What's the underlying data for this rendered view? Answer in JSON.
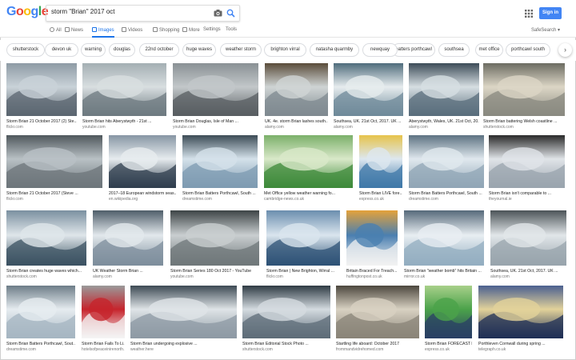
{
  "header": {
    "logo_letters": [
      "G",
      "o",
      "o",
      "g",
      "l",
      "e"
    ],
    "logo_colors": [
      "#4285f4",
      "#ea4335",
      "#fbbc05",
      "#4285f4",
      "#34a853",
      "#ea4335"
    ],
    "query": "storm \"Brian\" 2017 oct",
    "signin_label": "Sign in",
    "apps_icon": "apps-grid-icon",
    "camera_icon": "camera-icon",
    "search_icon": "search-icon"
  },
  "tabs": [
    {
      "label": "All",
      "icon": "search-icon",
      "active": false
    },
    {
      "label": "News",
      "icon": "news-icon",
      "active": false
    },
    {
      "label": "Images",
      "icon": "image-icon",
      "active": true
    },
    {
      "label": "Videos",
      "icon": "video-icon",
      "active": false
    },
    {
      "label": "Shopping",
      "icon": "tag-icon",
      "active": false
    },
    {
      "label": "More",
      "icon": "more-icon",
      "active": false
    },
    {
      "label": "Settings",
      "icon": "",
      "active": false
    },
    {
      "label": "Tools",
      "icon": "",
      "active": false
    }
  ],
  "safesearch_label": "SafeSearch ▾",
  "accent_color": "#1a73e8",
  "chips": [
    "shutterstock",
    "devon uk",
    "warning",
    "douglas",
    "22nd october",
    "huge waves",
    "weather storm",
    "brighton virral",
    "natasha quarmby",
    "newquay",
    "batters porthcawl",
    "southsea",
    "met office",
    "porthcawl south"
  ],
  "results": [
    {
      "caption": "Storm Brian 21 October 2017 (2) Ste...",
      "source": "flickr.com",
      "palette": [
        "#5b6670",
        "#c9d2d8",
        "#8e9ba5"
      ]
    },
    {
      "caption": "Storm Brian hits Aberystwyth - 21st ...",
      "source": "youtube.com",
      "palette": [
        "#6d7a80",
        "#d8dee0",
        "#a4afb3"
      ]
    },
    {
      "caption": "Storm Brian Douglas, Isle of Man ...",
      "source": "youtube.com",
      "palette": [
        "#585e62",
        "#c2c7c9",
        "#8a9195"
      ]
    },
    {
      "caption": "UK. 4e. storm Brian lashes south...",
      "source": "alamy.com",
      "palette": [
        "#7f8a90",
        "#cfd4d4",
        "#5a4c3a"
      ]
    },
    {
      "caption": "Southsea, UK. 21st Oct, 2017. UK ...",
      "source": "alamy.com",
      "palette": [
        "#6f8a9a",
        "#e6ecee",
        "#4f6c7c"
      ]
    },
    {
      "caption": "Aberystwyth, Wales, UK. 21st Oct, 20...",
      "source": "alamy.com",
      "palette": [
        "#5a6e7c",
        "#d6dee2",
        "#3d4c58"
      ]
    },
    {
      "caption": "Storm Brian battering Welsh coastline ...",
      "source": "shutterstock.com",
      "palette": [
        "#8a8a80",
        "#dcd6c6",
        "#6c6c62"
      ]
    },
    {
      "caption": "Storm Brian 21 October 2017 (Steve ...",
      "source": "flickr.com",
      "palette": [
        "#6d767b",
        "#b9c1c5",
        "#4f575c"
      ]
    },
    {
      "caption": "2017–18 European windstorm seas...",
      "source": "en.wikipedia.org",
      "palette": [
        "#2f3e4e",
        "#e7ecef",
        "#8796a4"
      ]
    },
    {
      "caption": "Storm Brian Batters Porthcawl, South ...",
      "source": "dreamstime.com",
      "palette": [
        "#7e9bb1",
        "#d4e1ea",
        "#3c4b55"
      ]
    },
    {
      "caption": "Met Office yellow weather warning fo...",
      "source": "cambridge-news.co.uk",
      "palette": [
        "#3d8a3a",
        "#d9e8c9",
        "#7bb06a"
      ]
    },
    {
      "caption": "Storm Brian LIVE fore...",
      "source": "express.co.uk",
      "palette": [
        "#3f78a8",
        "#dde7ef",
        "#e6c34b"
      ]
    },
    {
      "caption": "Storm Brian Batters Porthcawl, South ...",
      "source": "dreamstime.com",
      "palette": [
        "#90a6b6",
        "#e0e8ee",
        "#5d7282"
      ]
    },
    {
      "caption": "Storm Brian isn't comparable to ...",
      "source": "theyournal.ie",
      "palette": [
        "#9aa4ae",
        "#e0e4e8",
        "#2a2a2a"
      ]
    },
    {
      "caption": "Storm Brian creates huge waves which...",
      "source": "shutterstock.com",
      "palette": [
        "#3b5262",
        "#dfe6ea",
        "#7b90a0"
      ]
    },
    {
      "caption": "UK Weather Storm Brian ...",
      "source": "alamy.com",
      "palette": [
        "#7d8e9c",
        "#e2e8ec",
        "#4f5e6a"
      ]
    },
    {
      "caption": "Storm Brian Series 180 Oct 2017 - YouTube",
      "source": "youtube.com",
      "palette": [
        "#6f7779",
        "#c9ced0",
        "#3d4446"
      ]
    },
    {
      "caption": "Storm Brian | New Brighton, Wirral ...",
      "source": "flickr.com",
      "palette": [
        "#2d5276",
        "#dae5ee",
        "#6b8eae"
      ]
    },
    {
      "caption": "Britain Braced For Treach...",
      "source": "huffingtonpost.co.uk",
      "palette": [
        "#f2f2f2",
        "#4a7fb0",
        "#e5a23a"
      ]
    },
    {
      "caption": "Storm Brian \"weather bomb\" hits Britain ...",
      "source": "mirror.co.uk",
      "palette": [
        "#93adc0",
        "#e8eef2",
        "#56697a"
      ]
    },
    {
      "caption": "Southsea, UK. 21st Oct, 2017. UK ...",
      "source": "alamy.com",
      "palette": [
        "#98a4ac",
        "#e1e6e9",
        "#4c5458"
      ]
    },
    {
      "caption": "Storm Brian Batters Porthcawl, Sout...",
      "source": "dreamstime.com",
      "palette": [
        "#a6b6c2",
        "#e6ecf0",
        "#6d7d88"
      ]
    },
    {
      "caption": "Storm Brian Fails To Li...",
      "source": "hotelsofpeaceinirenorth...",
      "palette": [
        "#f4f4f4",
        "#c6242c",
        "#9a9a9a"
      ]
    },
    {
      "caption": "Storm Brian undergoing explosive ...",
      "source": "weather.here",
      "palette": [
        "#8d9aa4",
        "#dfe4e7",
        "#3d4a54"
      ]
    },
    {
      "caption": "Storm Brian Editorial Stock Photo ...",
      "source": "shutterstock.com",
      "palette": [
        "#5d6c78",
        "#d4dbe0",
        "#2f3b44"
      ]
    },
    {
      "caption": "Startling life aboard: October 2017",
      "source": "frommandvidrehomed.com",
      "palette": [
        "#8a8478",
        "#d8d1c2",
        "#4c473e"
      ]
    },
    {
      "caption": "Storm Brian FORECAST live ...",
      "source": "express.co.uk",
      "palette": [
        "#2a3f64",
        "#4ba24a",
        "#a8d08a"
      ]
    },
    {
      "caption": "Porthleven Cornwall during spring ...",
      "source": "telegraph.co.uk",
      "palette": [
        "#1f2f55",
        "#e2d29a",
        "#4b6090"
      ]
    }
  ]
}
